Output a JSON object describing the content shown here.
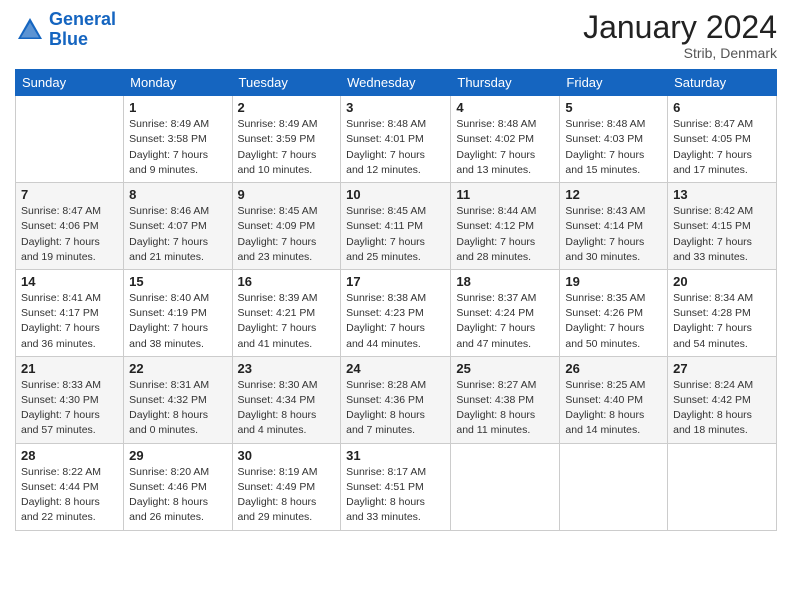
{
  "header": {
    "logo_line1": "General",
    "logo_line2": "Blue",
    "month_title": "January 2024",
    "location": "Strib, Denmark"
  },
  "weekdays": [
    "Sunday",
    "Monday",
    "Tuesday",
    "Wednesday",
    "Thursday",
    "Friday",
    "Saturday"
  ],
  "weeks": [
    [
      {
        "day": "",
        "info": ""
      },
      {
        "day": "1",
        "info": "Sunrise: 8:49 AM\nSunset: 3:58 PM\nDaylight: 7 hours\nand 9 minutes."
      },
      {
        "day": "2",
        "info": "Sunrise: 8:49 AM\nSunset: 3:59 PM\nDaylight: 7 hours\nand 10 minutes."
      },
      {
        "day": "3",
        "info": "Sunrise: 8:48 AM\nSunset: 4:01 PM\nDaylight: 7 hours\nand 12 minutes."
      },
      {
        "day": "4",
        "info": "Sunrise: 8:48 AM\nSunset: 4:02 PM\nDaylight: 7 hours\nand 13 minutes."
      },
      {
        "day": "5",
        "info": "Sunrise: 8:48 AM\nSunset: 4:03 PM\nDaylight: 7 hours\nand 15 minutes."
      },
      {
        "day": "6",
        "info": "Sunrise: 8:47 AM\nSunset: 4:05 PM\nDaylight: 7 hours\nand 17 minutes."
      }
    ],
    [
      {
        "day": "7",
        "info": "Sunrise: 8:47 AM\nSunset: 4:06 PM\nDaylight: 7 hours\nand 19 minutes."
      },
      {
        "day": "8",
        "info": "Sunrise: 8:46 AM\nSunset: 4:07 PM\nDaylight: 7 hours\nand 21 minutes."
      },
      {
        "day": "9",
        "info": "Sunrise: 8:45 AM\nSunset: 4:09 PM\nDaylight: 7 hours\nand 23 minutes."
      },
      {
        "day": "10",
        "info": "Sunrise: 8:45 AM\nSunset: 4:11 PM\nDaylight: 7 hours\nand 25 minutes."
      },
      {
        "day": "11",
        "info": "Sunrise: 8:44 AM\nSunset: 4:12 PM\nDaylight: 7 hours\nand 28 minutes."
      },
      {
        "day": "12",
        "info": "Sunrise: 8:43 AM\nSunset: 4:14 PM\nDaylight: 7 hours\nand 30 minutes."
      },
      {
        "day": "13",
        "info": "Sunrise: 8:42 AM\nSunset: 4:15 PM\nDaylight: 7 hours\nand 33 minutes."
      }
    ],
    [
      {
        "day": "14",
        "info": "Sunrise: 8:41 AM\nSunset: 4:17 PM\nDaylight: 7 hours\nand 36 minutes."
      },
      {
        "day": "15",
        "info": "Sunrise: 8:40 AM\nSunset: 4:19 PM\nDaylight: 7 hours\nand 38 minutes."
      },
      {
        "day": "16",
        "info": "Sunrise: 8:39 AM\nSunset: 4:21 PM\nDaylight: 7 hours\nand 41 minutes."
      },
      {
        "day": "17",
        "info": "Sunrise: 8:38 AM\nSunset: 4:23 PM\nDaylight: 7 hours\nand 44 minutes."
      },
      {
        "day": "18",
        "info": "Sunrise: 8:37 AM\nSunset: 4:24 PM\nDaylight: 7 hours\nand 47 minutes."
      },
      {
        "day": "19",
        "info": "Sunrise: 8:35 AM\nSunset: 4:26 PM\nDaylight: 7 hours\nand 50 minutes."
      },
      {
        "day": "20",
        "info": "Sunrise: 8:34 AM\nSunset: 4:28 PM\nDaylight: 7 hours\nand 54 minutes."
      }
    ],
    [
      {
        "day": "21",
        "info": "Sunrise: 8:33 AM\nSunset: 4:30 PM\nDaylight: 7 hours\nand 57 minutes."
      },
      {
        "day": "22",
        "info": "Sunrise: 8:31 AM\nSunset: 4:32 PM\nDaylight: 8 hours\nand 0 minutes."
      },
      {
        "day": "23",
        "info": "Sunrise: 8:30 AM\nSunset: 4:34 PM\nDaylight: 8 hours\nand 4 minutes."
      },
      {
        "day": "24",
        "info": "Sunrise: 8:28 AM\nSunset: 4:36 PM\nDaylight: 8 hours\nand 7 minutes."
      },
      {
        "day": "25",
        "info": "Sunrise: 8:27 AM\nSunset: 4:38 PM\nDaylight: 8 hours\nand 11 minutes."
      },
      {
        "day": "26",
        "info": "Sunrise: 8:25 AM\nSunset: 4:40 PM\nDaylight: 8 hours\nand 14 minutes."
      },
      {
        "day": "27",
        "info": "Sunrise: 8:24 AM\nSunset: 4:42 PM\nDaylight: 8 hours\nand 18 minutes."
      }
    ],
    [
      {
        "day": "28",
        "info": "Sunrise: 8:22 AM\nSunset: 4:44 PM\nDaylight: 8 hours\nand 22 minutes."
      },
      {
        "day": "29",
        "info": "Sunrise: 8:20 AM\nSunset: 4:46 PM\nDaylight: 8 hours\nand 26 minutes."
      },
      {
        "day": "30",
        "info": "Sunrise: 8:19 AM\nSunset: 4:49 PM\nDaylight: 8 hours\nand 29 minutes."
      },
      {
        "day": "31",
        "info": "Sunrise: 8:17 AM\nSunset: 4:51 PM\nDaylight: 8 hours\nand 33 minutes."
      },
      {
        "day": "",
        "info": ""
      },
      {
        "day": "",
        "info": ""
      },
      {
        "day": "",
        "info": ""
      }
    ]
  ]
}
